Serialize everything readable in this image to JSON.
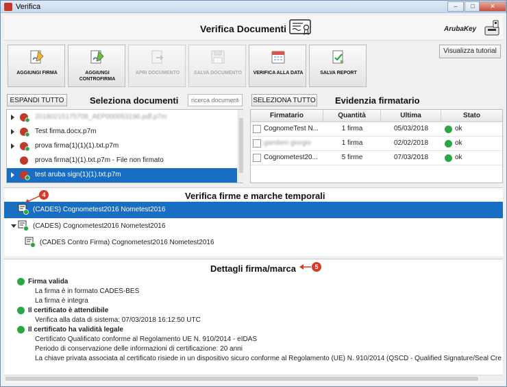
{
  "window": {
    "title": "Verifica",
    "controls": {
      "minimize": "–",
      "maximize": "□",
      "close": "✕"
    }
  },
  "header": {
    "title": "Verifica Documenti",
    "brand": "ArubaKey"
  },
  "toolbar": {
    "buttons": [
      {
        "label": "AGGIUNGI FIRMA",
        "enabled": true
      },
      {
        "label": "AGGIUNGI CONTROFIRMA",
        "enabled": true
      },
      {
        "label": "APRI DOCUMENTO",
        "enabled": false
      },
      {
        "label": "SALVA DOCUMENTO",
        "enabled": false
      },
      {
        "label": "VERIFICA ALLA DATA",
        "enabled": true
      },
      {
        "label": "SALVA REPORT",
        "enabled": true
      }
    ],
    "tutorial_label": "Visualizza tutorial"
  },
  "documents": {
    "expand_label": "ESPANDI TUTTO",
    "title": "Seleziona documenti",
    "search_placeholder": "ricerca documento",
    "items": [
      {
        "name": "20180215175708_AEP000053196.pdf.p7m",
        "blurred": true,
        "selected": false
      },
      {
        "name": "Test firma.docx.p7m",
        "blurred": false,
        "selected": false
      },
      {
        "name": "prova firma(1)(1)(1).txt.p7m",
        "blurred": false,
        "selected": false
      },
      {
        "name": "prova firma(1)(1).txt.p7m - File non firmato",
        "blurred": false,
        "selected": false
      },
      {
        "name": "test aruba sign(1)(1).txt.p7m",
        "blurred": false,
        "selected": true
      }
    ]
  },
  "signers": {
    "select_all_label": "SELEZIONA TUTTO",
    "title": "Evidenzia firmatario",
    "columns": [
      "Firmatario",
      "Quantità",
      "Ultima",
      "Stato"
    ],
    "rows": [
      {
        "firmatario": "CognomeTest N...",
        "quantita": "1 firma",
        "ultima": "05/03/2018",
        "stato": "ok",
        "blurred": false
      },
      {
        "firmatario": "gamberi giorgio",
        "quantita": "1 firma",
        "ultima": "02/02/2018",
        "stato": "ok",
        "blurred": true
      },
      {
        "firmatario": "Cognometest20...",
        "quantita": "5 firme",
        "ultima": "07/03/2018",
        "stato": "ok",
        "blurred": false
      }
    ]
  },
  "verification": {
    "title": "Verifica firme e marche temporali",
    "items": [
      {
        "text": "(CADES) Cognometest2016 Nometest2016",
        "selected": true
      },
      {
        "text": "(CADES) Cognometest2016 Nometest2016",
        "selected": false
      },
      {
        "text": "(CADES Contro Firma) Cognometest2016 Nometest2016",
        "selected": false
      }
    ],
    "callout": "4"
  },
  "details": {
    "title": "Dettagli firma/marca",
    "callout": "5",
    "sections": [
      {
        "heading": "Firma valida",
        "lines": [
          "La firma è in formato CADES-BES",
          "La firma è integra"
        ]
      },
      {
        "heading": "Il certificato è attendibile",
        "lines": [
          "Verifica alla data di sistema: 07/03/2018 16:12:50 UTC"
        ]
      },
      {
        "heading": "Il certificato ha validità legale",
        "lines": [
          "Certificato Qualificato conforme al Regolamento UE N. 910/2014 - eIDAS",
          "Periodo di conservazione delle informazioni di certificazione: 20 anni",
          "La chiave privata associata al certificato risiede in un dispositivo sicuro conforme al Regolamento (UE) N. 910/2014 (QSCD - Qualified Signature/Seal Creatio"
        ]
      }
    ]
  },
  "colors": {
    "selection": "#1a6ec2",
    "ok": "#27a844",
    "callout": "#d63a2b"
  }
}
